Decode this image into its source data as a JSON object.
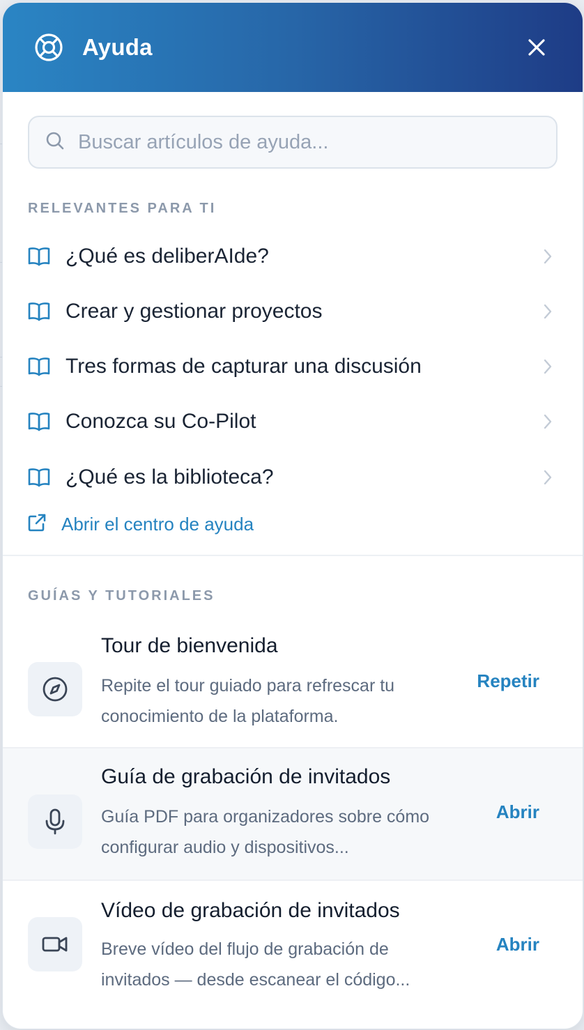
{
  "header": {
    "title": "Ayuda",
    "icon": "lifebuoy-icon",
    "close_icon": "close-icon",
    "gradient": [
      "#2a85c4",
      "#1e3c86"
    ]
  },
  "search": {
    "placeholder": "Buscar artículos de ayuda...",
    "value": ""
  },
  "relevant": {
    "label": "RELEVANTES PARA TI",
    "articles": [
      {
        "label": "¿Qué es deliberAIde?"
      },
      {
        "label": "Crear y gestionar proyectos"
      },
      {
        "label": "Tres formas de capturar una discusión"
      },
      {
        "label": "Conozca su Co-Pilot"
      },
      {
        "label": "¿Qué es la biblioteca?"
      }
    ],
    "open_center_label": "Abrir el centro de ayuda"
  },
  "guides": {
    "label": "GUÍAS Y TUTORIALES",
    "items": [
      {
        "title": "Tour de bienvenida",
        "description": "Repite el tour guiado para refrescar tu conocimiento de la plataforma.",
        "action": "Repetir",
        "icon": "compass-icon"
      },
      {
        "title": "Guía de grabación de invitados",
        "description": "Guía PDF para organizadores sobre cómo configurar audio y dispositivos...",
        "action": "Abrir",
        "icon": "microphone-icon"
      },
      {
        "title": "Vídeo de grabación de invitados",
        "description": "Breve vídeo del flujo de grabación de invitados — desde escanear el código...",
        "action": "Abrir",
        "icon": "video-camera-icon"
      }
    ]
  },
  "colors": {
    "accent": "#2583c0",
    "section_label": "#8c99ab",
    "text": "#1a2434",
    "muted": "#5d6b7f"
  }
}
